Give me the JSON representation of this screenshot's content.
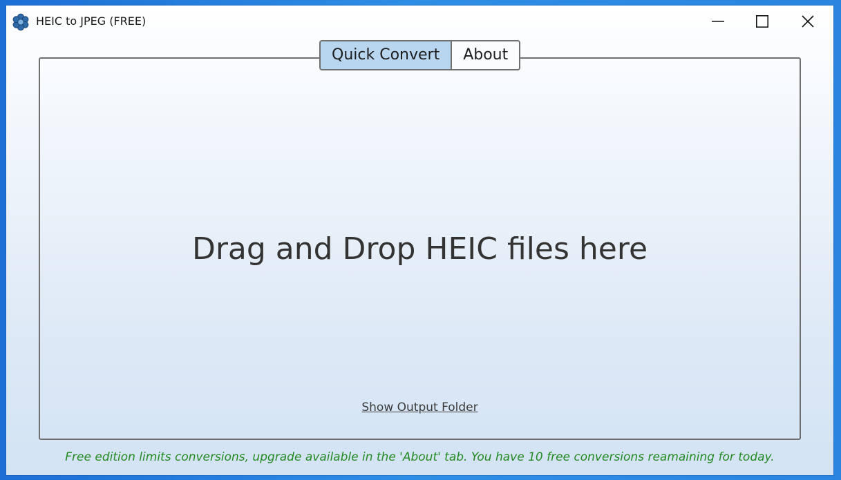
{
  "window": {
    "title": "HEIC to JPEG (FREE)",
    "app_icon": "flower-logo-icon",
    "controls": {
      "minimize": "minimize-icon",
      "maximize": "maximize-icon",
      "close": "close-icon"
    }
  },
  "tabs": [
    {
      "label": "Quick Convert",
      "active": true
    },
    {
      "label": "About",
      "active": false
    }
  ],
  "drop_area": {
    "message": "Drag and Drop HEIC files here",
    "output_link": "Show Output Folder"
  },
  "footer": {
    "notice": "Free edition limits conversions, upgrade available in the 'About' tab. You have 10 free conversions reamaining for today."
  },
  "colors": {
    "active_tab": "#b9d6f1",
    "notice_text": "#238a23",
    "border": "#6f6f6f"
  }
}
